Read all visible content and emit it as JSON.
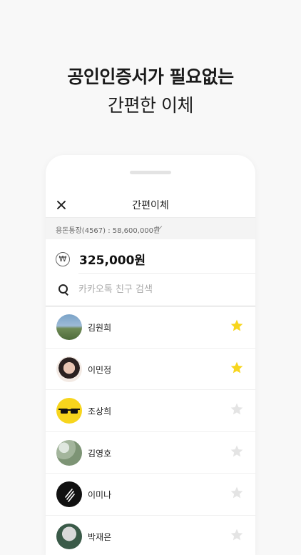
{
  "headline": {
    "line1": "공인인증서가 필요없는",
    "line2": "간편한 이체"
  },
  "nav": {
    "close_icon": "close-icon",
    "title": "간편이체"
  },
  "account": {
    "label": "용돈통장(4567) : 58,600,000원",
    "dropdown_icon": "chevron-down-icon"
  },
  "transfer": {
    "currency_icon": "won-icon",
    "currency_symbol": "₩",
    "amount": "325,000원"
  },
  "search": {
    "icon": "search-icon",
    "placeholder": "카카오톡 친구 검색",
    "value": ""
  },
  "colors": {
    "star_active": "#f7d51d",
    "star_inactive": "#e4e4e4",
    "background": "#f8f8f8"
  },
  "friends": [
    {
      "name": "김원희",
      "favorite": true
    },
    {
      "name": "이민정",
      "favorite": true
    },
    {
      "name": "조상희",
      "favorite": false
    },
    {
      "name": "김영호",
      "favorite": false
    },
    {
      "name": "이미나",
      "favorite": false
    },
    {
      "name": "박재은",
      "favorite": false
    }
  ]
}
